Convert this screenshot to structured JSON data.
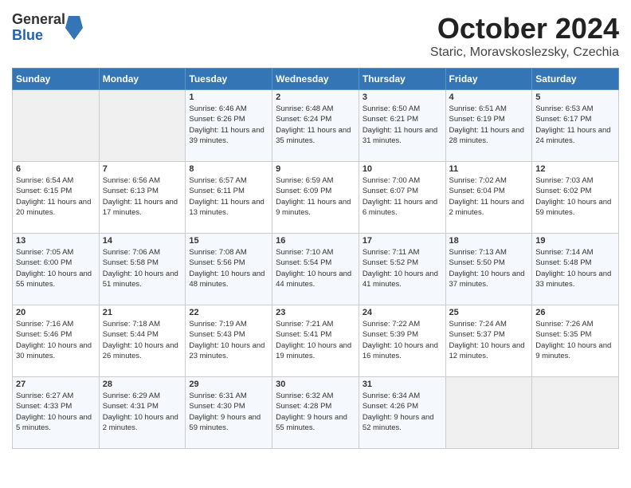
{
  "header": {
    "logo_general": "General",
    "logo_blue": "Blue",
    "month": "October 2024",
    "location": "Staric, Moravskoslezsky, Czechia"
  },
  "days_of_week": [
    "Sunday",
    "Monday",
    "Tuesday",
    "Wednesday",
    "Thursday",
    "Friday",
    "Saturday"
  ],
  "weeks": [
    [
      {
        "day": "",
        "sunrise": "",
        "sunset": "",
        "daylight": ""
      },
      {
        "day": "",
        "sunrise": "",
        "sunset": "",
        "daylight": ""
      },
      {
        "day": "1",
        "sunrise": "Sunrise: 6:46 AM",
        "sunset": "Sunset: 6:26 PM",
        "daylight": "Daylight: 11 hours and 39 minutes."
      },
      {
        "day": "2",
        "sunrise": "Sunrise: 6:48 AM",
        "sunset": "Sunset: 6:24 PM",
        "daylight": "Daylight: 11 hours and 35 minutes."
      },
      {
        "day": "3",
        "sunrise": "Sunrise: 6:50 AM",
        "sunset": "Sunset: 6:21 PM",
        "daylight": "Daylight: 11 hours and 31 minutes."
      },
      {
        "day": "4",
        "sunrise": "Sunrise: 6:51 AM",
        "sunset": "Sunset: 6:19 PM",
        "daylight": "Daylight: 11 hours and 28 minutes."
      },
      {
        "day": "5",
        "sunrise": "Sunrise: 6:53 AM",
        "sunset": "Sunset: 6:17 PM",
        "daylight": "Daylight: 11 hours and 24 minutes."
      }
    ],
    [
      {
        "day": "6",
        "sunrise": "Sunrise: 6:54 AM",
        "sunset": "Sunset: 6:15 PM",
        "daylight": "Daylight: 11 hours and 20 minutes."
      },
      {
        "day": "7",
        "sunrise": "Sunrise: 6:56 AM",
        "sunset": "Sunset: 6:13 PM",
        "daylight": "Daylight: 11 hours and 17 minutes."
      },
      {
        "day": "8",
        "sunrise": "Sunrise: 6:57 AM",
        "sunset": "Sunset: 6:11 PM",
        "daylight": "Daylight: 11 hours and 13 minutes."
      },
      {
        "day": "9",
        "sunrise": "Sunrise: 6:59 AM",
        "sunset": "Sunset: 6:09 PM",
        "daylight": "Daylight: 11 hours and 9 minutes."
      },
      {
        "day": "10",
        "sunrise": "Sunrise: 7:00 AM",
        "sunset": "Sunset: 6:07 PM",
        "daylight": "Daylight: 11 hours and 6 minutes."
      },
      {
        "day": "11",
        "sunrise": "Sunrise: 7:02 AM",
        "sunset": "Sunset: 6:04 PM",
        "daylight": "Daylight: 11 hours and 2 minutes."
      },
      {
        "day": "12",
        "sunrise": "Sunrise: 7:03 AM",
        "sunset": "Sunset: 6:02 PM",
        "daylight": "Daylight: 10 hours and 59 minutes."
      }
    ],
    [
      {
        "day": "13",
        "sunrise": "Sunrise: 7:05 AM",
        "sunset": "Sunset: 6:00 PM",
        "daylight": "Daylight: 10 hours and 55 minutes."
      },
      {
        "day": "14",
        "sunrise": "Sunrise: 7:06 AM",
        "sunset": "Sunset: 5:58 PM",
        "daylight": "Daylight: 10 hours and 51 minutes."
      },
      {
        "day": "15",
        "sunrise": "Sunrise: 7:08 AM",
        "sunset": "Sunset: 5:56 PM",
        "daylight": "Daylight: 10 hours and 48 minutes."
      },
      {
        "day": "16",
        "sunrise": "Sunrise: 7:10 AM",
        "sunset": "Sunset: 5:54 PM",
        "daylight": "Daylight: 10 hours and 44 minutes."
      },
      {
        "day": "17",
        "sunrise": "Sunrise: 7:11 AM",
        "sunset": "Sunset: 5:52 PM",
        "daylight": "Daylight: 10 hours and 41 minutes."
      },
      {
        "day": "18",
        "sunrise": "Sunrise: 7:13 AM",
        "sunset": "Sunset: 5:50 PM",
        "daylight": "Daylight: 10 hours and 37 minutes."
      },
      {
        "day": "19",
        "sunrise": "Sunrise: 7:14 AM",
        "sunset": "Sunset: 5:48 PM",
        "daylight": "Daylight: 10 hours and 33 minutes."
      }
    ],
    [
      {
        "day": "20",
        "sunrise": "Sunrise: 7:16 AM",
        "sunset": "Sunset: 5:46 PM",
        "daylight": "Daylight: 10 hours and 30 minutes."
      },
      {
        "day": "21",
        "sunrise": "Sunrise: 7:18 AM",
        "sunset": "Sunset: 5:44 PM",
        "daylight": "Daylight: 10 hours and 26 minutes."
      },
      {
        "day": "22",
        "sunrise": "Sunrise: 7:19 AM",
        "sunset": "Sunset: 5:43 PM",
        "daylight": "Daylight: 10 hours and 23 minutes."
      },
      {
        "day": "23",
        "sunrise": "Sunrise: 7:21 AM",
        "sunset": "Sunset: 5:41 PM",
        "daylight": "Daylight: 10 hours and 19 minutes."
      },
      {
        "day": "24",
        "sunrise": "Sunrise: 7:22 AM",
        "sunset": "Sunset: 5:39 PM",
        "daylight": "Daylight: 10 hours and 16 minutes."
      },
      {
        "day": "25",
        "sunrise": "Sunrise: 7:24 AM",
        "sunset": "Sunset: 5:37 PM",
        "daylight": "Daylight: 10 hours and 12 minutes."
      },
      {
        "day": "26",
        "sunrise": "Sunrise: 7:26 AM",
        "sunset": "Sunset: 5:35 PM",
        "daylight": "Daylight: 10 hours and 9 minutes."
      }
    ],
    [
      {
        "day": "27",
        "sunrise": "Sunrise: 6:27 AM",
        "sunset": "Sunset: 4:33 PM",
        "daylight": "Daylight: 10 hours and 5 minutes."
      },
      {
        "day": "28",
        "sunrise": "Sunrise: 6:29 AM",
        "sunset": "Sunset: 4:31 PM",
        "daylight": "Daylight: 10 hours and 2 minutes."
      },
      {
        "day": "29",
        "sunrise": "Sunrise: 6:31 AM",
        "sunset": "Sunset: 4:30 PM",
        "daylight": "Daylight: 9 hours and 59 minutes."
      },
      {
        "day": "30",
        "sunrise": "Sunrise: 6:32 AM",
        "sunset": "Sunset: 4:28 PM",
        "daylight": "Daylight: 9 hours and 55 minutes."
      },
      {
        "day": "31",
        "sunrise": "Sunrise: 6:34 AM",
        "sunset": "Sunset: 4:26 PM",
        "daylight": "Daylight: 9 hours and 52 minutes."
      },
      {
        "day": "",
        "sunrise": "",
        "sunset": "",
        "daylight": ""
      },
      {
        "day": "",
        "sunrise": "",
        "sunset": "",
        "daylight": ""
      }
    ]
  ]
}
